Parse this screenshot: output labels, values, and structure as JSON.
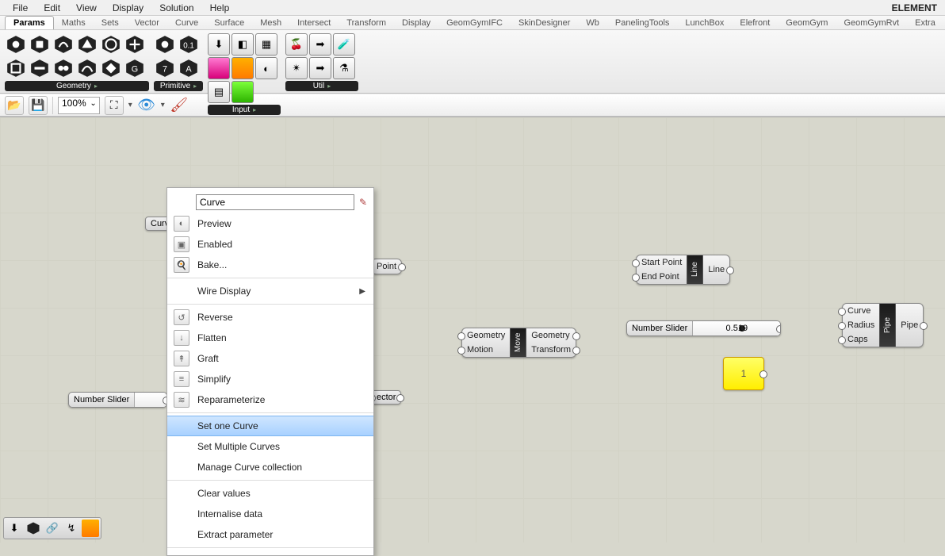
{
  "brand": "ELEMENT",
  "menubar": [
    "File",
    "Edit",
    "View",
    "Display",
    "Solution",
    "Help"
  ],
  "ribbon_tabs": [
    "Params",
    "Maths",
    "Sets",
    "Vector",
    "Curve",
    "Surface",
    "Mesh",
    "Intersect",
    "Transform",
    "Display",
    "GeomGymIFC",
    "SkinDesigner",
    "Wb",
    "PanelingTools",
    "LunchBox",
    "Elefront",
    "GeomGym",
    "GeomGymRvt",
    "Extra"
  ],
  "active_tab_index": 0,
  "ribbon_groups": {
    "geometry": "Geometry",
    "primitive": "Primitive",
    "input": "Input",
    "util": "Util"
  },
  "toolbar": {
    "zoom": "100%"
  },
  "context_menu": {
    "search_value": "Curve",
    "items": [
      {
        "label": "Preview",
        "icon": "preview-icon"
      },
      {
        "label": "Enabled",
        "icon": "enabled-icon"
      },
      {
        "label": "Bake...",
        "icon": "bake-icon"
      },
      {
        "sep": true
      },
      {
        "label": "Wire Display",
        "icon": "none",
        "submenu": true
      },
      {
        "sep": true
      },
      {
        "label": "Reverse",
        "icon": "reverse-icon"
      },
      {
        "label": "Flatten",
        "icon": "flatten-icon"
      },
      {
        "label": "Graft",
        "icon": "graft-icon"
      },
      {
        "label": "Simplify",
        "icon": "simplify-icon"
      },
      {
        "label": "Reparameterize",
        "icon": "reparam-icon"
      },
      {
        "sep": true
      },
      {
        "label": "Set one Curve",
        "icon": "none",
        "highlight": true
      },
      {
        "label": "Set Multiple Curves",
        "icon": "none"
      },
      {
        "label": "Manage Curve collection",
        "icon": "none"
      },
      {
        "sep": true
      },
      {
        "label": "Clear values",
        "icon": "none"
      },
      {
        "label": "Internalise data",
        "icon": "none"
      },
      {
        "label": "Extract parameter",
        "icon": "none"
      },
      {
        "sep": true
      }
    ]
  },
  "canvas": {
    "curve_param_label": "Curv",
    "point_comp": {
      "out": "Point"
    },
    "move_comp": {
      "ins": [
        "Geometry",
        "Motion"
      ],
      "mid": "Move",
      "outs": [
        "Geometry",
        "Transform"
      ]
    },
    "line_comp": {
      "ins": [
        "Start Point",
        "End Point"
      ],
      "mid": "Line",
      "outs": [
        "Line"
      ]
    },
    "pipe_comp": {
      "ins": [
        "Curve",
        "Radius",
        "Caps"
      ],
      "mid": "Pipe",
      "outs": [
        "Pipe"
      ]
    },
    "vector_tag": "ector",
    "slider1": {
      "label": "Number Slider"
    },
    "slider2": {
      "label": "Number Slider",
      "value": "0.519",
      "pos_pct": 52
    },
    "panel_value": "1"
  }
}
